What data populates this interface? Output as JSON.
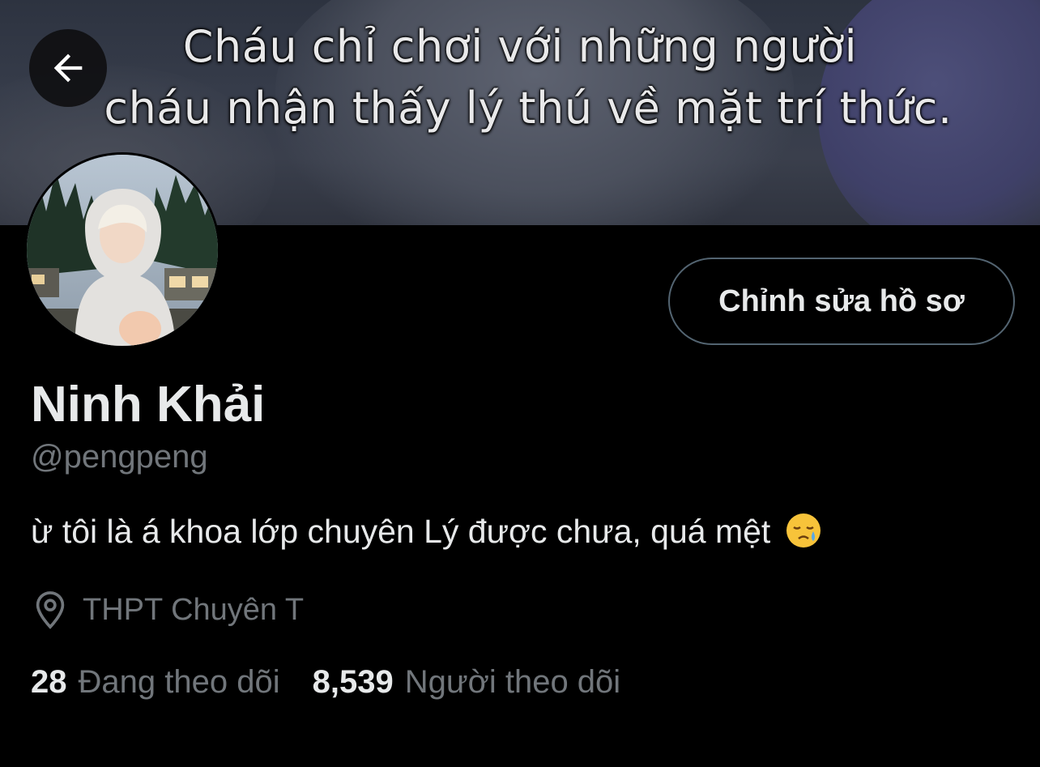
{
  "banner": {
    "caption_line1": "Cháu chỉ chơi với những người",
    "caption_line2": "cháu nhận thấy lý thú về mặt trí thức."
  },
  "header": {
    "back_icon": "arrow-left-icon"
  },
  "profile": {
    "edit_button_label": "Chỉnh sửa hồ sơ",
    "display_name": "Ninh Khải",
    "handle": "@pengpeng",
    "bio": "ừ tôi là á khoa lớp chuyên Lý được chưa, quá mệt",
    "bio_emoji": "sleepy-face-emoji",
    "location_icon": "location-pin-icon",
    "location": "THPT Chuyên T"
  },
  "stats": {
    "following_count": "28",
    "following_label": "Đang theo dõi",
    "followers_count": "8,539",
    "followers_label": "Người theo dõi"
  },
  "colors": {
    "background": "#000000",
    "primary_text": "#e7e9ea",
    "secondary_text": "#71767b",
    "button_border": "#536471"
  }
}
